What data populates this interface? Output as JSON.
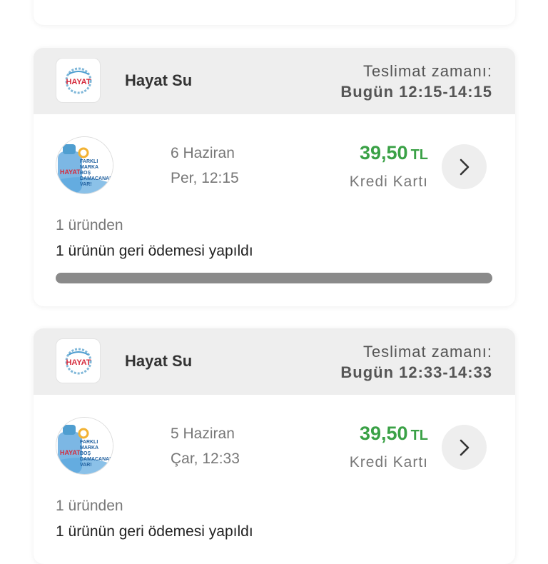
{
  "orders": [
    {
      "store_name": "Hayat Su",
      "delivery_label": "Teslimat zamanı:",
      "delivery_time": "Bugün 12:15-14:15",
      "date": "6 Haziran",
      "day_time": "Per, 12:15",
      "price": "39,50",
      "currency": "TL",
      "payment_method": "Kredi Kartı",
      "item_count": "1 üründen",
      "refund_status": "1 ürünün geri ödemesi yapıldı",
      "progress": 1.0
    },
    {
      "store_name": "Hayat Su",
      "delivery_label": "Teslimat zamanı:",
      "delivery_time": "Bugün 12:33-14:33",
      "date": "5 Haziran",
      "day_time": "Çar, 12:33",
      "price": "39,50",
      "currency": "TL",
      "payment_method": "Kredi Kartı",
      "item_count": "1 üründen",
      "refund_status": "1 ürünün geri ödemesi yapıldı"
    }
  ],
  "logo_text": "HAYAT",
  "product_badge_text": [
    "FARKLI",
    "MARKA",
    "BOŞ",
    "DAMACANAN",
    "VAR!"
  ],
  "icons": {
    "chevron": "chevron-right-icon"
  },
  "colors": {
    "price": "#3aa146",
    "header_bg": "#eeeeee",
    "progress": "#8a8a8a"
  }
}
